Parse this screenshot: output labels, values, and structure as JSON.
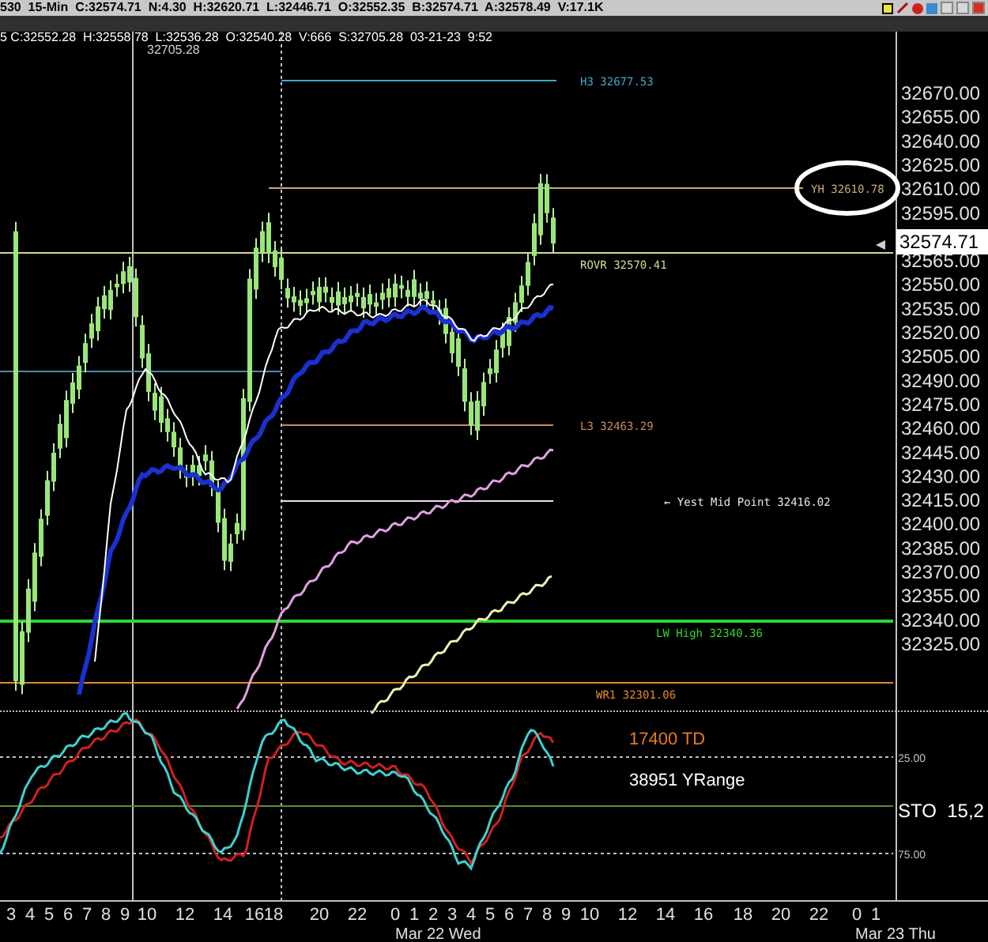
{
  "header": {
    "quote_line": "530  15-Min  C:32574.71  N:4.30  H:32620.71  L:32446.71  O:32552.35  B:32574.71  A:32578.49  V:17.1K",
    "bar_line": "5 C:32552.28  H:32558.78  L:32536.28  O:32540.28  V:666  S:32705.28  03-21-23  9:52"
  },
  "price_chart": {
    "high_label": "32705.28",
    "price_axis": [
      "32670.00",
      "32655.00",
      "32640.00",
      "32625.00",
      "32610.00",
      "32595.00",
      "32565.00",
      "32550.00",
      "32535.00",
      "32520.00",
      "32505.00",
      "32490.00",
      "32475.00",
      "32460.00",
      "32445.00",
      "32430.00",
      "32415.00",
      "32400.00",
      "32385.00",
      "32370.00",
      "32355.00",
      "32340.00",
      "32325.00"
    ],
    "last_price": "32574.71",
    "levels": [
      {
        "label": "H3 32677.53",
        "color": "#3fa9c9",
        "kind": "short"
      },
      {
        "label": "YH 32610.78",
        "color": "#c9a97a",
        "kind": "circled"
      },
      {
        "label": "ROVR 32570.41",
        "color": "#d8d890",
        "kind": "full"
      },
      {
        "label": "L3 32463.29",
        "color": "#c98a5a",
        "kind": "short"
      },
      {
        "label": "← Yest Mid Point 32416.02",
        "color": "#f0e0f0",
        "kind": "short"
      },
      {
        "label": "LW High 32340.36",
        "color": "#2ed82e",
        "kind": "thick"
      },
      {
        "label": "WR1 32301.06",
        "color": "#e08a2a",
        "kind": "full"
      }
    ]
  },
  "oscillator": {
    "td": "17400 TD",
    "yrange": "38951 YRange",
    "upper": "25.00",
    "lower": "75.00",
    "name": "STO  15,2"
  },
  "time_axis": {
    "labels": [
      "3",
      "4",
      "5",
      "6",
      "7",
      "8",
      "9",
      "10",
      "12",
      "14",
      "16",
      "18",
      "20",
      "22",
      "0",
      "1",
      "2",
      "3",
      "4",
      "5",
      "6",
      "7",
      "8",
      "9",
      "10",
      "12",
      "14",
      "16",
      "18",
      "20",
      "22",
      "0",
      "1"
    ],
    "dates": [
      "Mar 22 Wed",
      "Mar 23 Thu"
    ]
  }
}
